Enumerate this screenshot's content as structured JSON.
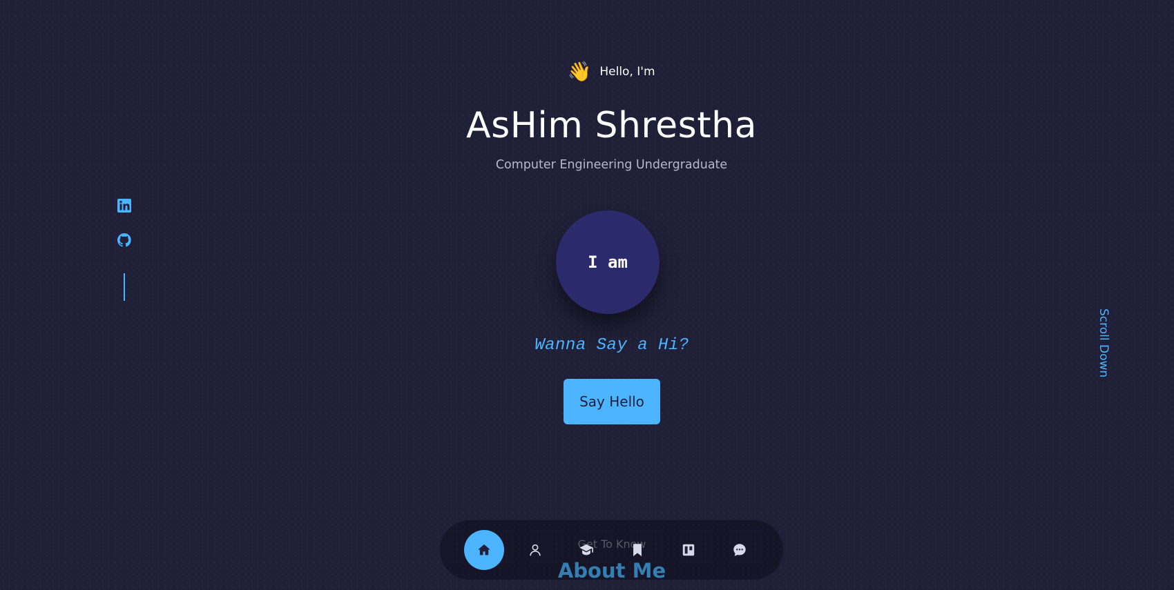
{
  "hero": {
    "greeting_emoji": "👋",
    "greeting": "Hello, I'm",
    "name": "AsHim Shrestha",
    "subtitle": "Computer Engineering Undergraduate",
    "avatar_text": "I am",
    "cta_question": "Wanna Say a Hi?",
    "cta_button": "Say Hello"
  },
  "socials": [
    {
      "icon": "linkedin-icon"
    },
    {
      "icon": "github-icon"
    }
  ],
  "scroll_down": "Scroll Down",
  "about": {
    "subtitle": "Get To Know",
    "title": "About Me"
  },
  "nav": {
    "items": [
      {
        "icon": "home-icon",
        "active": true
      },
      {
        "icon": "user-icon",
        "active": false
      },
      {
        "icon": "graduation-cap-icon",
        "active": false
      },
      {
        "icon": "bookmark-icon",
        "active": false
      },
      {
        "icon": "projects-board-icon",
        "active": false
      },
      {
        "icon": "chat-icon",
        "active": false
      }
    ]
  },
  "colors": {
    "background": "#1f1f38",
    "accent": "#4db5ff",
    "avatar": "#2b2a6b",
    "text": "#ffffff",
    "muted": "#b8b8c8"
  }
}
